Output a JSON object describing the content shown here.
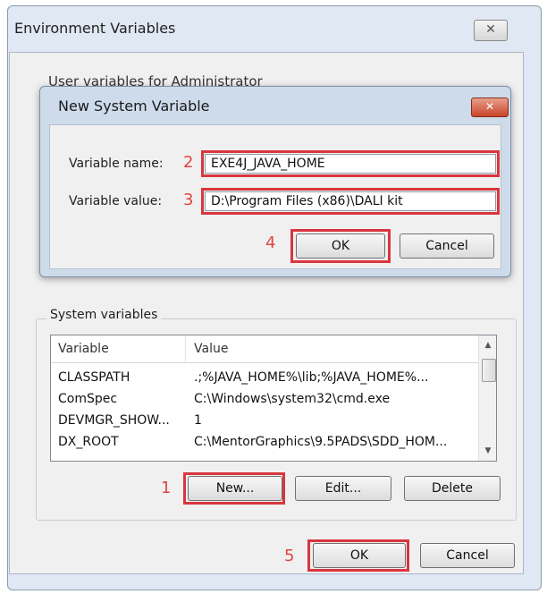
{
  "outer_dialog": {
    "title": "Environment Variables",
    "close_glyph": "✕",
    "user_section_label": "User variables for Administrator"
  },
  "new_var_dialog": {
    "title": "New System Variable",
    "close_glyph": "✕",
    "name_label": "Variable name:",
    "value_label": "Variable value:",
    "name_value": "EXE4J_JAVA_HOME",
    "value_value": "D:\\Program Files (x86)\\DALI kit",
    "ok_label": "OK",
    "cancel_label": "Cancel"
  },
  "system_vars": {
    "group_label": "System variables",
    "columns": [
      "Variable",
      "Value"
    ],
    "rows": [
      {
        "name": "CLASSPATH",
        "value": ".;%JAVA_HOME%\\lib;%JAVA_HOME%..."
      },
      {
        "name": "ComSpec",
        "value": "C:\\Windows\\system32\\cmd.exe"
      },
      {
        "name": "DEVMGR_SHOW...",
        "value": "1"
      },
      {
        "name": "DX_ROOT",
        "value": "C:\\MentorGraphics\\9.5PADS\\SDD_HOM..."
      }
    ],
    "new_label": "New...",
    "edit_label": "Edit...",
    "delete_label": "Delete"
  },
  "footer": {
    "ok_label": "OK",
    "cancel_label": "Cancel"
  },
  "annotations": {
    "step1": "1",
    "step2": "2",
    "step3": "3",
    "step4": "4",
    "step5": "5",
    "highlight_color": "#d9363e"
  }
}
